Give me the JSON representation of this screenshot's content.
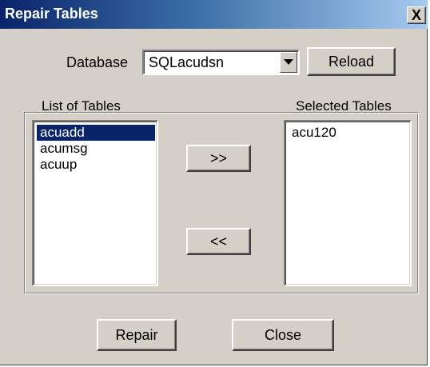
{
  "window": {
    "title": "Repair Tables",
    "close_symbol": "X"
  },
  "database": {
    "label": "Database",
    "selected": "SQLacudsn",
    "reload_label": "Reload"
  },
  "lists": {
    "available_label": "List of Tables",
    "selected_label": "Selected Tables",
    "available": [
      {
        "name": "acuadd",
        "selected": true
      },
      {
        "name": "acumsg",
        "selected": false
      },
      {
        "name": "acuup",
        "selected": false
      }
    ],
    "chosen": [
      {
        "name": "acu120"
      }
    ]
  },
  "buttons": {
    "add": ">>",
    "remove": "<<",
    "repair": "Repair",
    "close": "Close"
  },
  "colors": {
    "face": "#d4d0c8",
    "selection": "#0a246a",
    "titlebar_start": "#0a246a",
    "titlebar_end": "#a6caf0"
  }
}
